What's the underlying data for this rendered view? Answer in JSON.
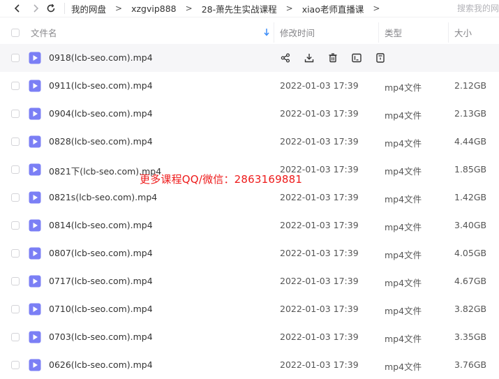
{
  "breadcrumb": [
    "我的网盘",
    "xzgvip888",
    "28-萧先生实战课程",
    "xiao老师直播课"
  ],
  "search": {
    "placeholder": "搜索我的网盘文件"
  },
  "columns": {
    "name": "文件名",
    "mtime": "修改时间",
    "type": "类型",
    "size": "大小"
  },
  "files": [
    {
      "name": "0918(lcb-seo.com).mp4",
      "mtime": "",
      "type": "",
      "size": ""
    },
    {
      "name": "0911(lcb-seo.com).mp4",
      "mtime": "2022-01-03 17:39",
      "type": "mp4文件",
      "size": "2.12GB"
    },
    {
      "name": "0904(lcb-seo.com).mp4",
      "mtime": "2022-01-03 17:39",
      "type": "mp4文件",
      "size": "2.13GB"
    },
    {
      "name": "0828(lcb-seo.com).mp4",
      "mtime": "2022-01-03 17:39",
      "type": "mp4文件",
      "size": "4.44GB"
    },
    {
      "name": "0821下(lcb-seo.com).mp4",
      "mtime": "2022-01-03 17:39",
      "type": "mp4文件",
      "size": "1.85GB"
    },
    {
      "name": "0821s(lcb-seo.com).mp4",
      "mtime": "2022-01-03 17:39",
      "type": "mp4文件",
      "size": "1.42GB"
    },
    {
      "name": "0814(lcb-seo.com).mp4",
      "mtime": "2022-01-03 17:39",
      "type": "mp4文件",
      "size": "3.40GB"
    },
    {
      "name": "0807(lcb-seo.com).mp4",
      "mtime": "2022-01-03 17:39",
      "type": "mp4文件",
      "size": "4.05GB"
    },
    {
      "name": "0717(lcb-seo.com).mp4",
      "mtime": "2022-01-03 17:39",
      "type": "mp4文件",
      "size": "4.67GB"
    },
    {
      "name": "0710(lcb-seo.com).mp4",
      "mtime": "2022-01-03 17:39",
      "type": "mp4文件",
      "size": "3.82GB"
    },
    {
      "name": "0703(lcb-seo.com).mp4",
      "mtime": "2022-01-03 17:39",
      "type": "mp4文件",
      "size": "3.35GB"
    },
    {
      "name": "0626(lcb-seo.com).mp4",
      "mtime": "2022-01-03 17:39",
      "type": "mp4文件",
      "size": "3.76GB"
    }
  ],
  "hover_actions": [
    "share-icon",
    "download-icon",
    "delete-icon",
    "rename-icon",
    "more-icon"
  ],
  "watermark": "更多课程QQ/微信：2863169881",
  "colors": {
    "file_icon": "#7b7ff5",
    "watermark": "#ee1a1a",
    "sort_arrow": "#3e8ef7"
  }
}
